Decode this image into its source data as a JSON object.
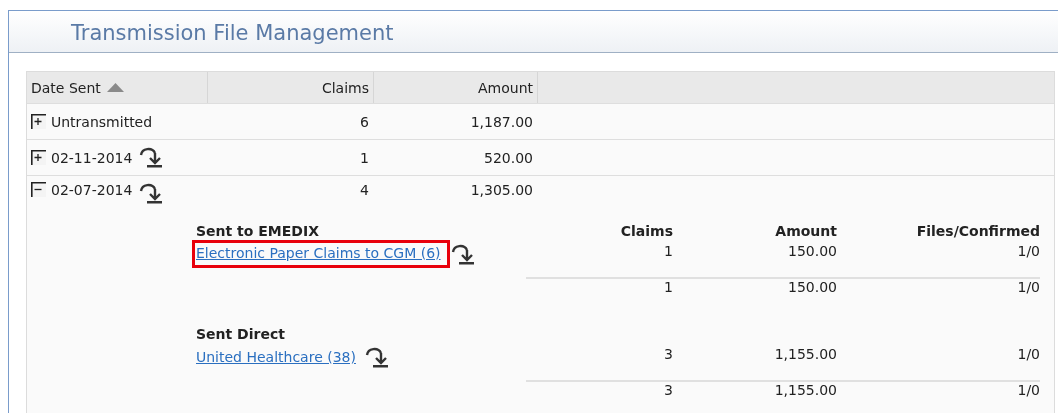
{
  "title": "Transmission File Management",
  "table": {
    "columns": [
      {
        "label": "Date Sent",
        "sorted": true
      },
      {
        "label": "Claims",
        "sorted": false
      },
      {
        "label": "Amount",
        "sorted": false
      }
    ],
    "rows": [
      {
        "date": "Untransmitted",
        "claims": "6",
        "amount": "1,187.00",
        "expanded": false,
        "download": false
      },
      {
        "date": "02-11-2014",
        "claims": "1",
        "amount": "520.00",
        "expanded": false,
        "download": true
      },
      {
        "date": "02-07-2014",
        "claims": "4",
        "amount": "1,305.00",
        "expanded": true,
        "download": true,
        "detail": {
          "columns": [
            "Claims",
            "Amount",
            "Files/Confirmed"
          ],
          "groups": [
            {
              "title": "Sent to EMEDIX",
              "items": [
                {
                  "label": "Electronic Paper Claims to CGM (6)",
                  "highlighted": true,
                  "claims": "1",
                  "amount": "150.00",
                  "files": "1/0"
                }
              ],
              "total": {
                "claims": "1",
                "amount": "150.00",
                "files": "1/0"
              }
            },
            {
              "title": "Sent Direct",
              "items": [
                {
                  "label": "United Healthcare (38)",
                  "highlighted": false,
                  "claims": "3",
                  "amount": "1,155.00",
                  "files": "1/0"
                }
              ],
              "total": {
                "claims": "3",
                "amount": "1,155.00",
                "files": "1/0"
              }
            }
          ]
        }
      }
    ]
  }
}
